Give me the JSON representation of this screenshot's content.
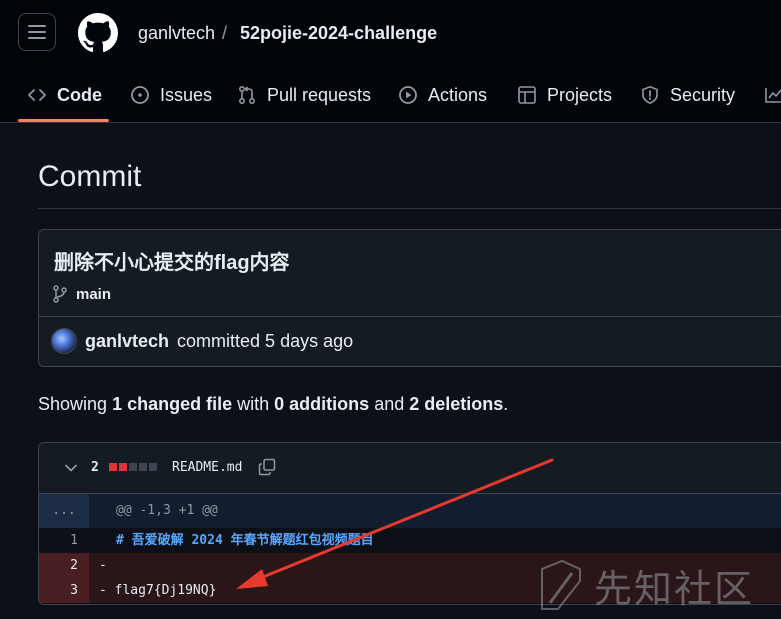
{
  "header": {
    "owner": "ganlvtech",
    "separator": "/",
    "repo": "52pojie-2024-challenge"
  },
  "tabs": [
    {
      "label": "Code",
      "icon": "code-icon"
    },
    {
      "label": "Issues",
      "icon": "issue-icon"
    },
    {
      "label": "Pull requests",
      "icon": "pull-request-icon"
    },
    {
      "label": "Actions",
      "icon": "play-icon"
    },
    {
      "label": "Projects",
      "icon": "table-icon"
    },
    {
      "label": "Security",
      "icon": "shield-icon"
    }
  ],
  "page": {
    "title": "Commit"
  },
  "commit": {
    "message": "删除不小心提交的flag内容",
    "branch": "main",
    "author": "ganlvtech",
    "committed_text": "committed 5 days ago"
  },
  "summary": {
    "showing": "Showing",
    "changed_files": "1 changed file",
    "with": "with",
    "additions": "0 additions",
    "and": "and",
    "deletions": "2 deletions",
    "period": "."
  },
  "diff": {
    "change_count": "2",
    "filename": "README.md",
    "hunk_marker": "...",
    "hunk_header": "@@ -1,3 +1 @@",
    "lines": [
      {
        "num": "1",
        "text": "# 吾爱破解 2024 年春节解题红包视频题目"
      },
      {
        "num": "2",
        "text": "-"
      },
      {
        "num": "3",
        "text": "- flag7{Dj19NQ}"
      }
    ]
  },
  "watermark": {
    "text": "先知社区"
  },
  "colors": {
    "background": "#0d1117",
    "accent_underline": "#f78166",
    "deletion": "#da3633",
    "annotation_arrow": "#e8392f"
  }
}
